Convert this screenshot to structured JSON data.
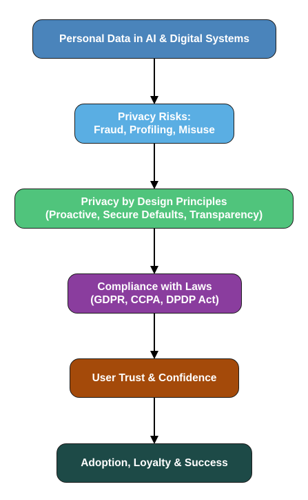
{
  "nodes": [
    {
      "id": "personal-data",
      "lines": [
        "Personal Data in AI & Digital Systems"
      ],
      "color": "#4a84bb"
    },
    {
      "id": "privacy-risks",
      "lines": [
        "Privacy Risks:",
        "Fraud, Profiling, Misuse"
      ],
      "color": "#5aaee3"
    },
    {
      "id": "privacy-by-design",
      "lines": [
        "Privacy by Design Principles",
        "(Proactive, Secure Defaults, Transparency)"
      ],
      "color": "#50c47c"
    },
    {
      "id": "compliance",
      "lines": [
        "Compliance with Laws",
        "(GDPR, CCPA, DPDP Act)"
      ],
      "color": "#8a3d9e"
    },
    {
      "id": "user-trust",
      "lines": [
        "User Trust & Confidence"
      ],
      "color": "#a44a0a"
    },
    {
      "id": "adoption",
      "lines": [
        "Adoption, Loyalty & Success"
      ],
      "color": "#1d4a47"
    }
  ],
  "edges": [
    {
      "from": "personal-data",
      "to": "privacy-risks"
    },
    {
      "from": "privacy-risks",
      "to": "privacy-by-design"
    },
    {
      "from": "privacy-by-design",
      "to": "compliance"
    },
    {
      "from": "compliance",
      "to": "user-trust"
    },
    {
      "from": "user-trust",
      "to": "adoption"
    }
  ]
}
